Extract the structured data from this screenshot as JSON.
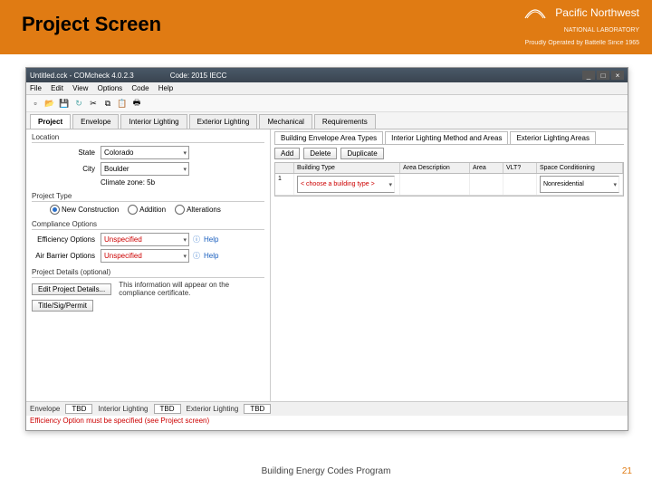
{
  "slide": {
    "title": "Project Screen",
    "footer": "Building Energy Codes Program",
    "page": "21"
  },
  "banner": {
    "org": "Pacific Northwest",
    "org2": "NATIONAL LABORATORY",
    "tagline": "Proudly Operated by Battelle Since 1965"
  },
  "window": {
    "title": "Untitled.cck - COMcheck 4.0.2.3",
    "code_label": "Code: 2015 IECC",
    "menu": [
      "File",
      "Edit",
      "View",
      "Options",
      "Code",
      "Help"
    ],
    "toolbar": [
      "new",
      "open",
      "save",
      "refresh",
      "cut",
      "copy",
      "paste",
      "print"
    ],
    "tabs": [
      "Project",
      "Envelope",
      "Interior Lighting",
      "Exterior Lighting",
      "Mechanical",
      "Requirements"
    ],
    "active_tab": 0
  },
  "left": {
    "location": {
      "title": "Location",
      "state_label": "State",
      "state_value": "Colorado",
      "city_label": "City",
      "city_value": "Boulder",
      "zone": "Climate zone: 5b"
    },
    "project_type": {
      "title": "Project Type",
      "options": [
        "New Construction",
        "Addition",
        "Alterations"
      ],
      "selected": 0
    },
    "compliance": {
      "title": "Compliance Options",
      "eff_label": "Efficiency Options",
      "eff_value": "Unspecified",
      "air_label": "Air Barrier Options",
      "air_value": "Unspecified",
      "help": "Help"
    },
    "details": {
      "title": "Project Details (optional)",
      "edit_btn": "Edit Project Details...",
      "titlesig_btn": "Title/Sig/Permit",
      "note": "This information will appear on the compliance certificate."
    }
  },
  "right": {
    "subtabs": [
      "Building Envelope Area Types",
      "Interior Lighting Method and Areas",
      "Exterior Lighting Areas"
    ],
    "actions": [
      "Add",
      "Delete",
      "Duplicate"
    ],
    "cols": [
      "",
      "Building Type",
      "Area Description",
      "Area",
      "VLT?",
      "Space Conditioning"
    ],
    "row1_prompt": "< choose a building type >",
    "row1_cond": "Nonresidential"
  },
  "status": {
    "envelope_label": "Envelope",
    "tbd": "TBD",
    "int_label": "Interior Lighting",
    "ext_label": "Exterior Lighting"
  },
  "error": "Efficiency Option must be specified (see Project screen)"
}
